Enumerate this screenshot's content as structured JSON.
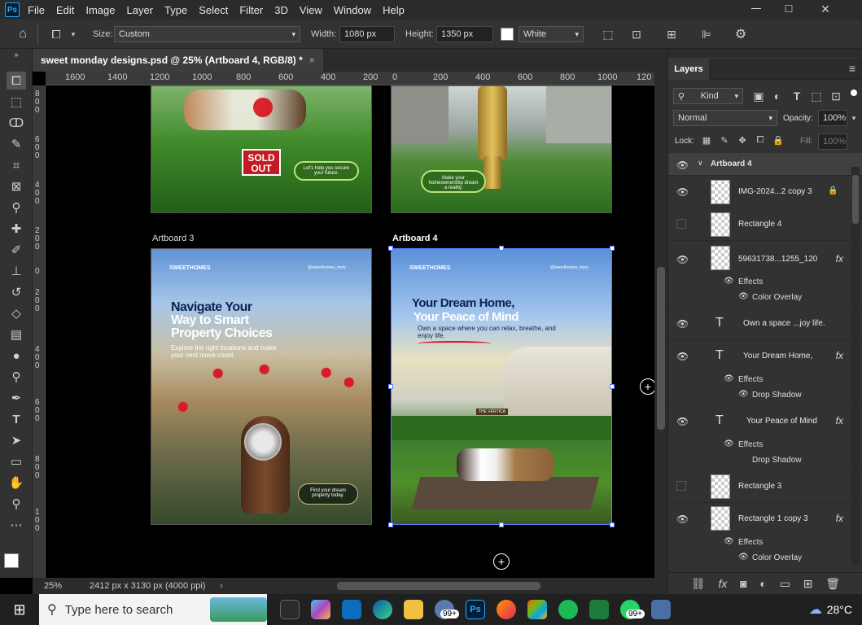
{
  "app": {
    "logo": "Ps"
  },
  "menu": [
    "File",
    "Edit",
    "Image",
    "Layer",
    "Type",
    "Select",
    "Filter",
    "3D",
    "View",
    "Window",
    "Help"
  ],
  "options": {
    "size_label": "Size:",
    "size_value": "Custom",
    "width_label": "Width:",
    "width_value": "1080 px",
    "height_label": "Height:",
    "height_value": "1350 px",
    "color_value": "White"
  },
  "document": {
    "tab_title": "sweet monday designs.psd @ 25% (Artboard 4, RGB/8) *",
    "close": "×"
  },
  "ruler": {
    "h_labels": [
      "1600",
      "1400",
      "1200",
      "1000",
      "800",
      "600",
      "400",
      "200",
      "0",
      "200",
      "400",
      "600",
      "800",
      "1000",
      "120"
    ],
    "v_labels": [
      "800",
      "600",
      "400",
      "200",
      "0",
      "200",
      "400",
      "600",
      "800",
      "100"
    ]
  },
  "artboards": {
    "a1": {
      "sold_out": "SOLD OUT",
      "cta": "Let's help you secure your future."
    },
    "a2": {
      "cta": "Make your homeownership dream a reality."
    },
    "a3": {
      "label": "Artboard 3",
      "brand": "SWEETHOMES",
      "handle": "@sweethomes_mory",
      "headline1": "Navigate Your",
      "headline2": "Way to Smart",
      "headline3": "Property Choices",
      "sub": "Explore the right locations and make your next move count",
      "cta": "Find your dream property today."
    },
    "a4": {
      "label": "Artboard 4",
      "brand": "SWEETHOMES",
      "handle": "@sweethomes_mory",
      "headline1": "Your Dream Home,",
      "headline2": "Your Peace of Mind",
      "sub": "Own a space where you can relax, breathe, and enjoy life.",
      "building_sign": "THE VERTICA"
    }
  },
  "status": {
    "zoom": "25%",
    "doc_info": "2412 px x 3130 px (4000 ppi)"
  },
  "layers_panel": {
    "title": "Layers",
    "kind": "Kind",
    "blend_mode": "Normal",
    "opacity_label": "Opacity:",
    "opacity_value": "100%",
    "lock_label": "Lock:",
    "fill_label": "Fill:",
    "fill_value": "100%",
    "group": "Artboard 4",
    "layers": [
      {
        "name": "IMG-2024...2 copy 3",
        "visible": true
      },
      {
        "name": "Rectangle 4",
        "visible": false
      },
      {
        "name": "59631738...1255_120",
        "visible": true,
        "fx": "fx"
      },
      {
        "name": "Own a space ...joy life.",
        "visible": true
      },
      {
        "name": "Your Dream Home,",
        "visible": true,
        "fx": "fx"
      },
      {
        "name": "Your Peace of Mind",
        "visible": true,
        "fx": "fx"
      },
      {
        "name": "Rectangle 3",
        "visible": false
      },
      {
        "name": "Rectangle 1 copy 3",
        "visible": true,
        "fx": "fx"
      }
    ],
    "effects_label": "Effects",
    "effects": [
      "Color Overlay",
      "Drop Shadow",
      "Drop Shadow",
      "Color Overlay"
    ]
  },
  "taskbar": {
    "search_placeholder": "Type here to search",
    "badge": "99+",
    "badge2": "99+",
    "temperature": "28°C"
  }
}
